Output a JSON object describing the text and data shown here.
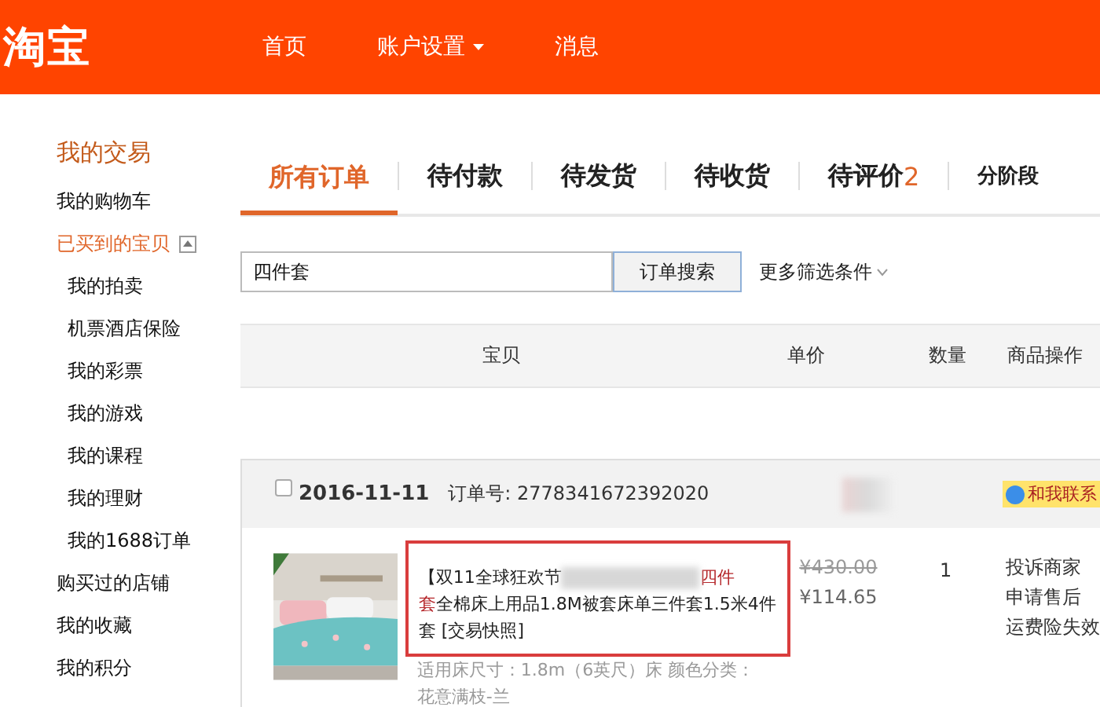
{
  "header": {
    "logo": "淘宝",
    "nav": [
      {
        "label": "首页",
        "dropdown": false
      },
      {
        "label": "账户设置",
        "dropdown": true
      },
      {
        "label": "消息",
        "dropdown": false
      }
    ]
  },
  "sidebar": {
    "title": "我的交易",
    "items": [
      {
        "label": "我的购物车",
        "selected": false
      },
      {
        "label": "已买到的宝贝",
        "selected": true,
        "expanded": true,
        "children": [
          {
            "label": "我的拍卖"
          },
          {
            "label": "机票酒店保险"
          },
          {
            "label": "我的彩票"
          },
          {
            "label": "我的游戏"
          },
          {
            "label": "我的课程"
          },
          {
            "label": "我的理财"
          },
          {
            "label": "我的1688订单"
          }
        ]
      },
      {
        "label": "购买过的店铺",
        "selected": false
      },
      {
        "label": "我的收藏",
        "selected": false
      },
      {
        "label": "我的积分",
        "selected": false
      }
    ]
  },
  "tabs": [
    {
      "label": "所有订单",
      "selected": true
    },
    {
      "label": "待付款",
      "selected": false
    },
    {
      "label": "待发货",
      "selected": false
    },
    {
      "label": "待收货",
      "selected": false
    },
    {
      "label": "待评价",
      "count": "2",
      "selected": false
    },
    {
      "label": "分阶段",
      "selected": false,
      "small": true
    }
  ],
  "search": {
    "value": "四件套",
    "button": "订单搜索",
    "more": "更多筛选条件"
  },
  "table": {
    "columns": [
      "宝贝",
      "单价",
      "数量",
      "商品操作"
    ]
  },
  "order": {
    "checked": false,
    "date": "2016-11-11",
    "number_label": "订单号:",
    "number": "2778341672392020",
    "contact": "和我联系",
    "item": {
      "title_before": "【双11全球狂欢节",
      "highlight_a": "四件",
      "highlight_b": "套",
      "title_after": "全棉床上用品1.8M被套床单三件套1.5米4件套",
      "snapshot": "[交易快照]",
      "specs": "适用床尺寸：1.8m（6英尺）床  颜色分类：花意满枝-兰",
      "original_price": "¥430.00",
      "price": "¥114.65",
      "quantity": "1",
      "actions": [
        "投诉商家",
        "申请售后",
        "运费险失效"
      ]
    }
  }
}
